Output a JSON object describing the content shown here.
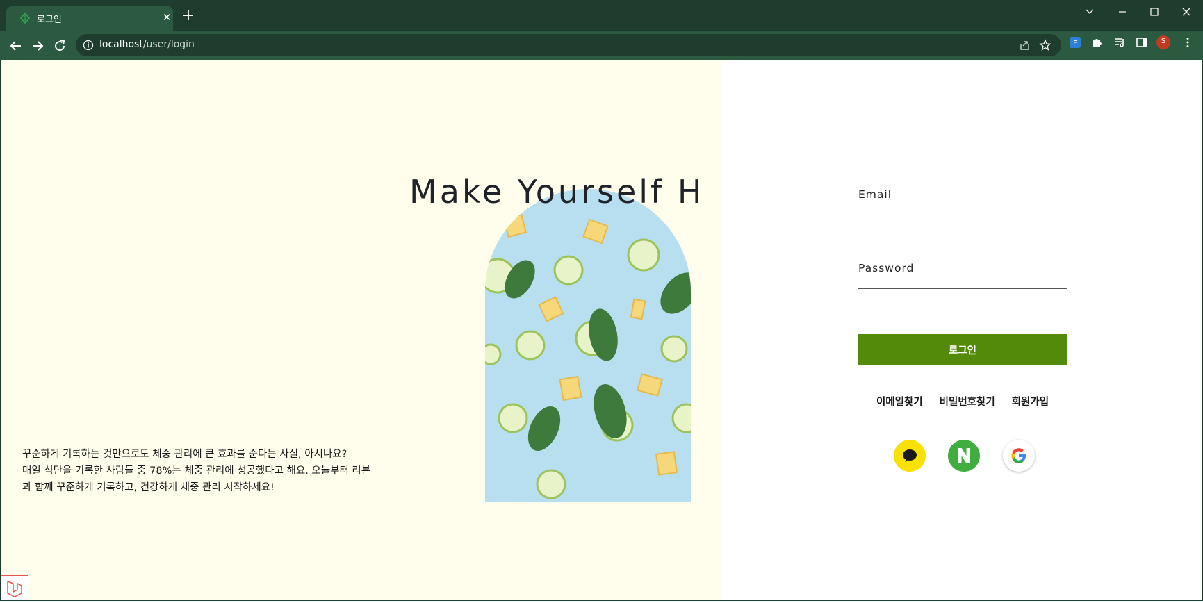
{
  "browser": {
    "tab_title": "로그인",
    "tab_close": "✕",
    "new_tab": "+",
    "url_host": "localhost",
    "url_path": "/user/login",
    "avatar_letter": "S"
  },
  "page": {
    "hero_title": "Make Yourself H",
    "intro_lines": [
      "꾸준하게 기록하는 것만으로도 체중 관리에 큰 효과를 준다는 사실, 아시나요?",
      "매일 식단을 기록한 사람들 중 78%는 체중 관리에 성공했다고 해요. 오늘부터 리본",
      "과 함께 꾸준하게 기록하고, 건강하게 체중 관리 시작하세요!"
    ]
  },
  "form": {
    "email_label": "Email",
    "email_value": "",
    "password_label": "Password",
    "password_value": "",
    "login_button": "로그인",
    "find_email": "이메일찾기",
    "find_password": "비밀번호찾기",
    "signup": "회원가입",
    "naver_letter": "N"
  },
  "colors": {
    "chrome_dark": "#1e3d2f",
    "chrome_mid": "#2b5a40",
    "left_bg": "#fffeec",
    "login_button": "#548a0a",
    "kakao": "#fae100",
    "naver": "#3fae3f"
  }
}
